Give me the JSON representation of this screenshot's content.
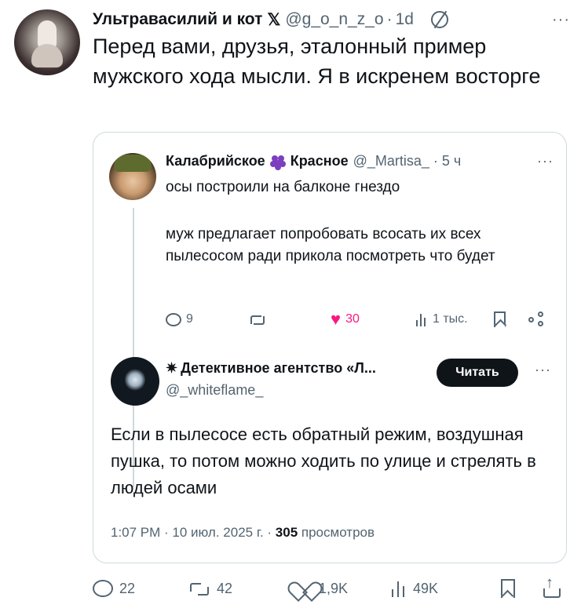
{
  "tweet": {
    "author_name": "Ультравасилий и кот",
    "x_mark": "𝕏",
    "handle": "@g_o_n_z_o",
    "separator": "·",
    "time": "1d",
    "more": "···",
    "text": "Перед вами, друзья, эталонный пример мужского хода мысли. Я в искренем восторге"
  },
  "quoted": {
    "author_name_1": "Калабрийское",
    "author_name_2": "Красное",
    "handle": "@_Martisa_",
    "separator": "·",
    "time": "5 ч",
    "more": "···",
    "text_1": "осы построили на балконе гнездо",
    "text_2": "муж предлагает попробовать всосать их всех пылесосом ради прикола посмотреть что будет",
    "actions": {
      "replies": "9",
      "likes": "30",
      "views": "1 тыс."
    }
  },
  "reply": {
    "star": "✷",
    "author_name": "Детективное агентство «Л...",
    "handle": "@_whiteflame_",
    "read_button": "Читать",
    "more": "···",
    "text": "Если в пылесосе есть обратный режим, воздушная пушка, то потом можно ходить по улице и стрелять в людей осами",
    "meta_prefix": "1:07 PM · 10 июл. 2025 г. · ",
    "views_count": "305",
    "views_label": " просмотров"
  },
  "bottom_bar": {
    "replies": "22",
    "retweets": "42",
    "likes": "1,9K",
    "views": "49K"
  },
  "colors": {
    "text": "#0f1419",
    "secondary": "#536471",
    "border": "#cfd9de",
    "like": "#f91880",
    "button_bg": "#0f1419"
  }
}
